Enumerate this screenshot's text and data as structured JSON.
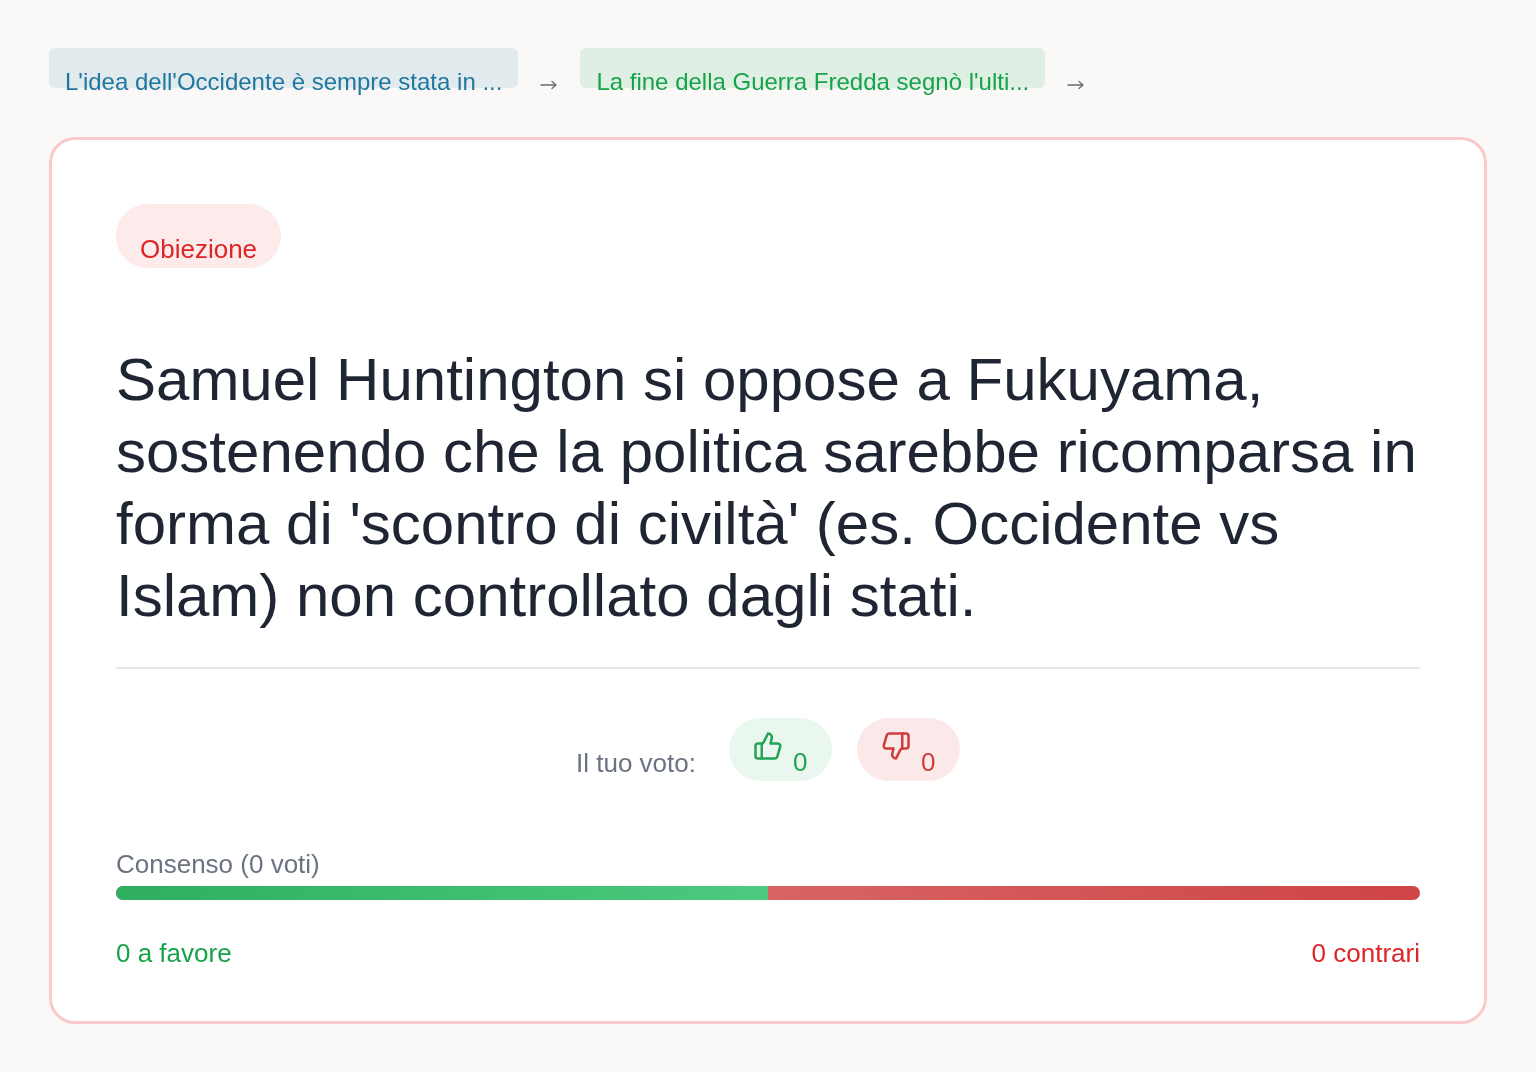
{
  "breadcrumbs": [
    {
      "label": "L'idea dell'Occidente è sempre stata in ...",
      "color": "#1f77a0"
    },
    {
      "label": "La fine della Guerra Fredda segnò l'ulti...",
      "color": "#16a34a"
    }
  ],
  "card": {
    "badge": "Obiezione",
    "statement": "Samuel Huntington si oppose a Fukuyama, sostenendo che la politica sarebbe ricomparsa in forma di 'scontro di civiltà' (es. Occidente vs Islam) non controllato dagli stati.",
    "vote": {
      "label": "Il tuo voto:",
      "buttons": [
        {
          "kind": "up",
          "count": "0"
        },
        {
          "kind": "down",
          "count": "0"
        }
      ]
    },
    "consensus": {
      "label": "Consenso (0 voti)",
      "level": 0.5,
      "for_label": "0 a favore",
      "against_label": "0 contrari"
    }
  }
}
